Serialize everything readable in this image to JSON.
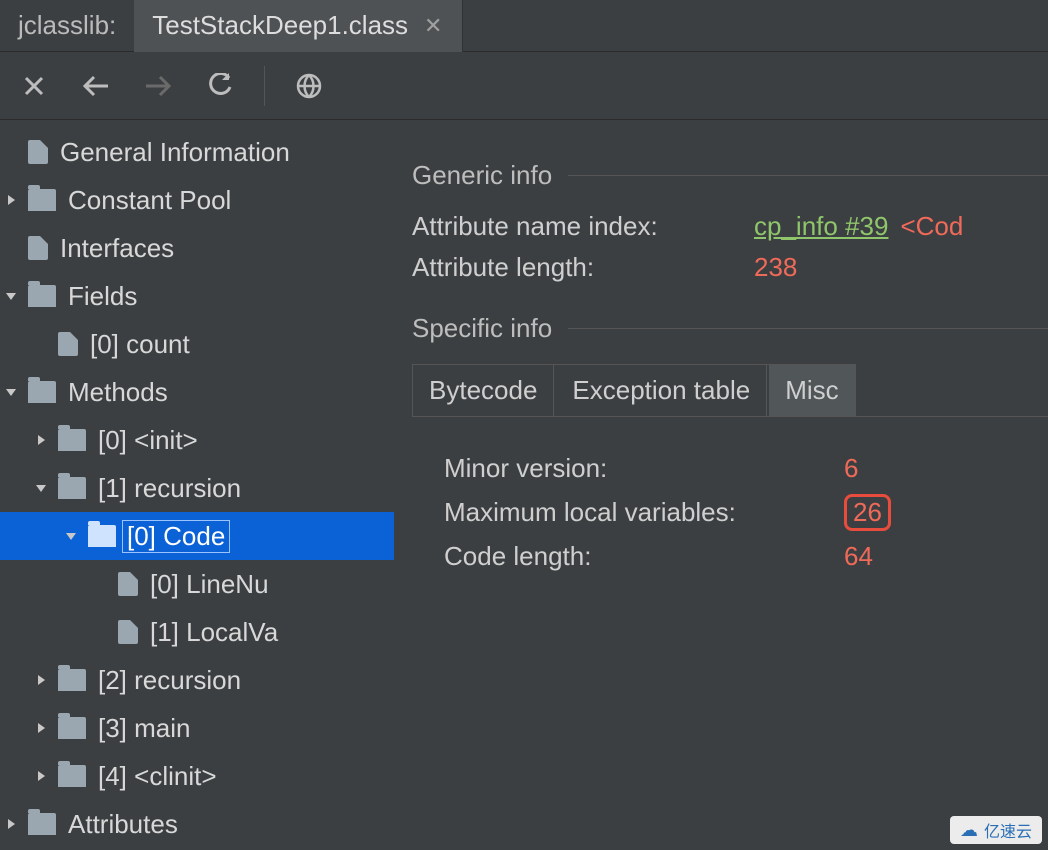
{
  "titlebar": {
    "app": "jclasslib:",
    "tab": "TestStackDeep1.class"
  },
  "tree": {
    "items": [
      {
        "label": "General Information",
        "kind": "file",
        "depth": 1,
        "disclosure": "none"
      },
      {
        "label": "Constant Pool",
        "kind": "folder",
        "depth": 1,
        "disclosure": "closed"
      },
      {
        "label": "Interfaces",
        "kind": "file",
        "depth": 1,
        "disclosure": "none"
      },
      {
        "label": "Fields",
        "kind": "folder",
        "depth": 1,
        "disclosure": "open"
      },
      {
        "label": "[0] count",
        "kind": "file",
        "depth": 2,
        "disclosure": "none"
      },
      {
        "label": "Methods",
        "kind": "folder",
        "depth": 1,
        "disclosure": "open"
      },
      {
        "label": "[0] <init>",
        "kind": "folder",
        "depth": 2,
        "disclosure": "closed"
      },
      {
        "label": "[1] recursion",
        "kind": "folder",
        "depth": 2,
        "disclosure": "open"
      },
      {
        "label": "[0] Code",
        "kind": "folder",
        "depth": 3,
        "disclosure": "open",
        "selected": true
      },
      {
        "label": "[0] LineNu",
        "kind": "file",
        "depth": 4,
        "disclosure": "none"
      },
      {
        "label": "[1] LocalVa",
        "kind": "file",
        "depth": 4,
        "disclosure": "none"
      },
      {
        "label": "[2] recursion",
        "kind": "folder",
        "depth": 2,
        "disclosure": "closed"
      },
      {
        "label": "[3] main",
        "kind": "folder",
        "depth": 2,
        "disclosure": "closed"
      },
      {
        "label": "[4] <clinit>",
        "kind": "folder",
        "depth": 2,
        "disclosure": "closed"
      },
      {
        "label": "Attributes",
        "kind": "folder",
        "depth": 1,
        "disclosure": "closed"
      }
    ]
  },
  "detail": {
    "generic_title": "Generic info",
    "attr_name_label": "Attribute name index:",
    "attr_name_link": "cp_info #39",
    "attr_name_extra": "<Cod",
    "attr_len_label": "Attribute length:",
    "attr_len_value": "238",
    "specific_title": "Specific info",
    "tabs": {
      "bytecode": "Bytecode",
      "exception": "Exception table",
      "misc": "Misc"
    },
    "misc": {
      "minor_label": "Minor version:",
      "minor_value": "6",
      "maxloc_label": "Maximum local variables:",
      "maxloc_value": "26",
      "codelen_label": "Code length:",
      "codelen_value": "64"
    }
  },
  "watermark": "亿速云"
}
